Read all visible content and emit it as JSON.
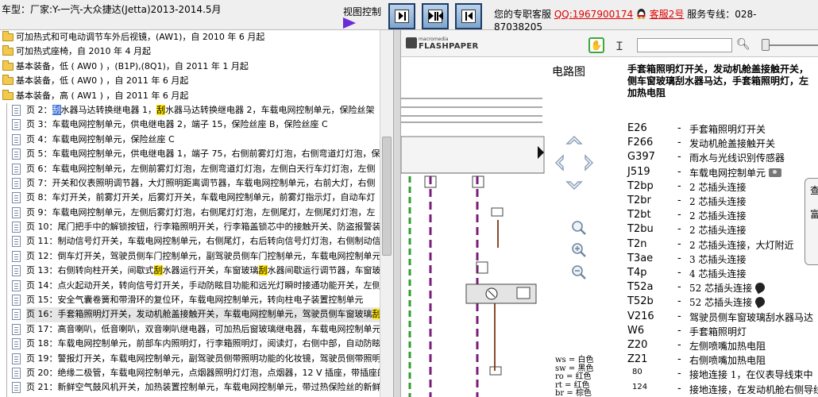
{
  "header": {
    "model_title": "车型：厂家:Y-一汽-大众捷达(Jetta)2013-2014.5月",
    "view_control_label": "视图控制",
    "service_prefix": "您的专职客服",
    "qq_link": "QQ:1967900174",
    "qq_service_link": "客服2号",
    "hotline_label": "服务专线：028-",
    "hotline_number": "87038205"
  },
  "tree": {
    "folders": [
      "可加热式和可电动调节车外后视镜，(AW1)，自 2010 年 6 月起",
      "可加热式座椅，自 2010 年 4 月起",
      "基本装备，低 ( AW0 ) ，(B1P),(8Q1)，自 2011 年 1 月起",
      "基本装备，低 ( AW0 ) ，自 2011 年 6 月起",
      "基本装备，高 ( AW1 ) ，自 2011 年 6 月起"
    ],
    "pages": [
      {
        "pre": "页 2：",
        "hl_sel": "刮",
        "mid": "水器马达转换继电器 1，",
        "hl": "刮",
        "post": "水器马达转换继电器 2，车载电网控制单元，保险丝架"
      },
      {
        "pre": "页 3：车载电网控制单元，供电继电器 2，端子 15，保险丝座 B，保险丝座 C"
      },
      {
        "pre": "页 4：车载电网控制单元，保险丝座 C"
      },
      {
        "pre": "页 5：车载电网控制单元，供电继电器 1，端子 75，右侧前雾灯灯泡，右侧弯道灯灯泡，保"
      },
      {
        "pre": "页 6：车载电网控制单元，左侧前雾灯灯泡，左侧弯道灯灯泡，左侧白天行车灯灯泡，左侧"
      },
      {
        "pre": "页 7：开关和仪表照明调节器，大灯照明距离调节器，车载电网控制单元，右前大灯，右侧"
      },
      {
        "pre": "页 8：车灯开关，前雾灯开关，后雾灯开关，车载电网控制单元，前雾灯指示灯，自动车灯"
      },
      {
        "pre": "页 9：车载电网控制单元，左侧后雾灯灯泡，右侧尾灯灯泡，左侧尾灯，左侧尾灯灯泡，左"
      },
      {
        "pre": "页 10：尾门把手中的解锁按钮，行李箱照明开关，行李箱盖锁芯中的接触开关、防盗报警装"
      },
      {
        "pre": "页 11：制动信号灯开关，车载电网控制单元，右侧尾灯，右后转向信号灯灯泡，右侧制动信"
      },
      {
        "pre": "页 12：倒车灯开关，驾驶员侧车门控制单元，副驾驶员侧车门控制单元，车载电网控制单元"
      },
      {
        "pre": "页 13：右侧转向柱开关，间歇式",
        "hl": "刮",
        "mid": "水器运行开关，车窗玻璃",
        "hl2": "刮",
        "post": "水器间歇运行调节器，车窗玻"
      },
      {
        "pre": "页 14：点火起动开关，转向信号灯开关，手动防眩目功能和远光灯瞬时接通功能开关，左侧"
      },
      {
        "pre": "页 15：安全气囊卷簧和带滑环的复位环，车载电网控制单元，转向柱电子装置控制单元"
      },
      {
        "pre": "页 16：手套箱照明灯开关，发动机舱盖接触开关，车载电网控制单元，驾驶员侧车窗玻璃",
        "hl": "刮",
        "selected": true
      },
      {
        "pre": "页 17：高音喇叭，低音喇叭，双音喇叭继电器，可加热后窗玻璃继电器，车载电网控制单元"
      },
      {
        "pre": "页 18：车载电网控制单元，前部车内照明灯，行李箱照明灯，阅读灯，右侧中部，自动防眩的"
      },
      {
        "pre": "页 19：警报灯开关，车载电网控制单元，副驾驶员侧带照明功能的化妆镜，驾驶员侧带照明"
      },
      {
        "pre": "页 20：绝缘二极管，车载电网控制单元，点烟器照明灯灯泡，点烟器，12 V 插座，带插座的"
      },
      {
        "pre": "页 21：新鲜空气鼓风机开关，加热装置控制单元，车载电网控制单元，带过热保险丝的新鲜"
      },
      {
        "pre": "页 22：防盗锁止系统识读线圈，手制动器指示灯开关，制动液液位警告信号触点，防盗锁止"
      }
    ]
  },
  "viewer": {
    "logo_small": "macromedia",
    "logo_brand": "FLASHPAPER",
    "search_value": "",
    "zoom_fraction": 0.0
  },
  "doc": {
    "title": "电路图",
    "description_lines": [
      "手套箱照明灯开关，发动机舱盖接触开关，",
      "侧车窗玻璃刮水器马达，手套箱照明灯，左",
      "加热电阻"
    ],
    "legend": [
      {
        "code": "E26",
        "text": "手套箱照明灯开关"
      },
      {
        "code": "F266",
        "text": "发动机舱盖接触开关"
      },
      {
        "code": "G397",
        "text": "雨水与光线识别传感器"
      },
      {
        "code": "J519",
        "text": "车载电网控制单元",
        "icon": "camera-icon"
      },
      {
        "code": "T2bp",
        "text": "2 芯插头连接"
      },
      {
        "code": "T2br",
        "text": "2 芯插头连接"
      },
      {
        "code": "T2bt",
        "text": "2 芯插头连接"
      },
      {
        "code": "T2bu",
        "text": "2 芯插头连接"
      },
      {
        "code": "T2n",
        "text": "2 芯插头连接，大灯附近"
      },
      {
        "code": "T3ae",
        "text": "3 芯插头连接"
      },
      {
        "code": "T4p",
        "text": "4 芯插头连接"
      },
      {
        "code": "T52a",
        "text": "52 芯插头连接",
        "icon": "plug-icon"
      },
      {
        "code": "T52b",
        "text": "52 芯插头连接",
        "icon": "plug-icon"
      },
      {
        "code": "V216",
        "text": "驾驶员侧车窗玻璃刮水器马达"
      },
      {
        "code": "W6",
        "text": "手套箱照明灯"
      },
      {
        "code": "Z20",
        "text": "左侧喷嘴加热电阻"
      },
      {
        "code": "Z21",
        "text": "右侧喷嘴加热电阻"
      },
      {
        "code": "80",
        "text": "接地连接 1，在仪表导线束中",
        "small": true
      },
      {
        "code": "124",
        "text": "接地连接，在发动机舱右侧导线",
        "small": true
      }
    ],
    "color_key": [
      {
        "abbr": "ws",
        "name": "白色"
      },
      {
        "abbr": "sw",
        "name": "黑色"
      },
      {
        "abbr": "ro",
        "name": "红色"
      },
      {
        "abbr": "rt",
        "name": "红色"
      },
      {
        "abbr": "br",
        "name": "棕色"
      }
    ],
    "floating_panel_chars": [
      "查",
      "富"
    ]
  },
  "colors": {
    "purple_wire": "#7a1e7a",
    "green_wire": "#2e9e2e",
    "brown_wire": "#8b4a2b",
    "view_arrow": "#6a2bd9"
  }
}
